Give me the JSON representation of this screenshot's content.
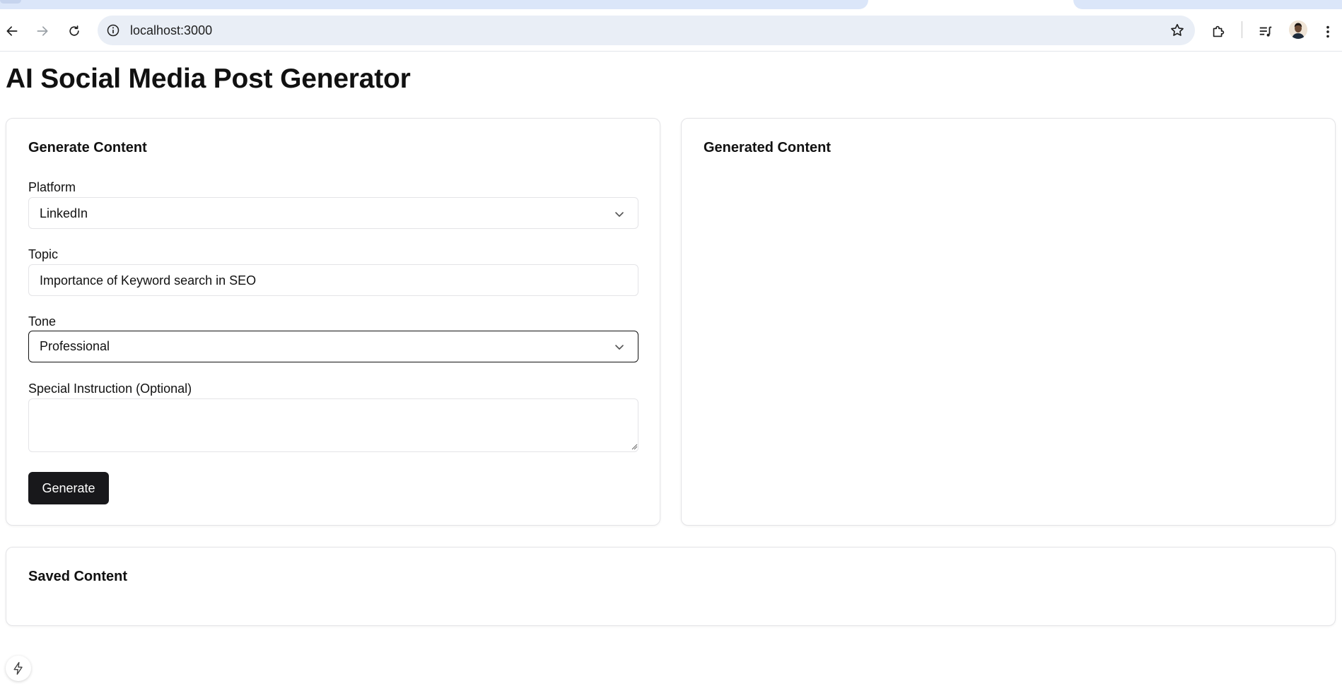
{
  "browser": {
    "url": "localhost:3000",
    "icons": [
      "back-arrow-icon",
      "forward-arrow-icon",
      "reload-icon",
      "site-info-icon",
      "bookmark-star-icon",
      "extensions-puzzle-icon",
      "media-playlist-icon",
      "profile-avatar",
      "more-vert-icon"
    ]
  },
  "page": {
    "title": "AI Social Media Post Generator"
  },
  "generate_card": {
    "title": "Generate Content",
    "platform": {
      "label": "Platform",
      "value": "LinkedIn"
    },
    "topic": {
      "label": "Topic",
      "value": "Importance of Keyword search in SEO"
    },
    "tone": {
      "label": "Tone",
      "value": "Professional"
    },
    "special": {
      "label": "Special Instruction (Optional)",
      "value": ""
    },
    "button": "Generate"
  },
  "generated_card": {
    "title": "Generated Content"
  },
  "saved_card": {
    "title": "Saved Content"
  },
  "colors": {
    "accent": "#18181b",
    "tab_strip": "#dbe6f9",
    "omnibox": "#e9eef6",
    "card_border": "#e4e4e7"
  }
}
